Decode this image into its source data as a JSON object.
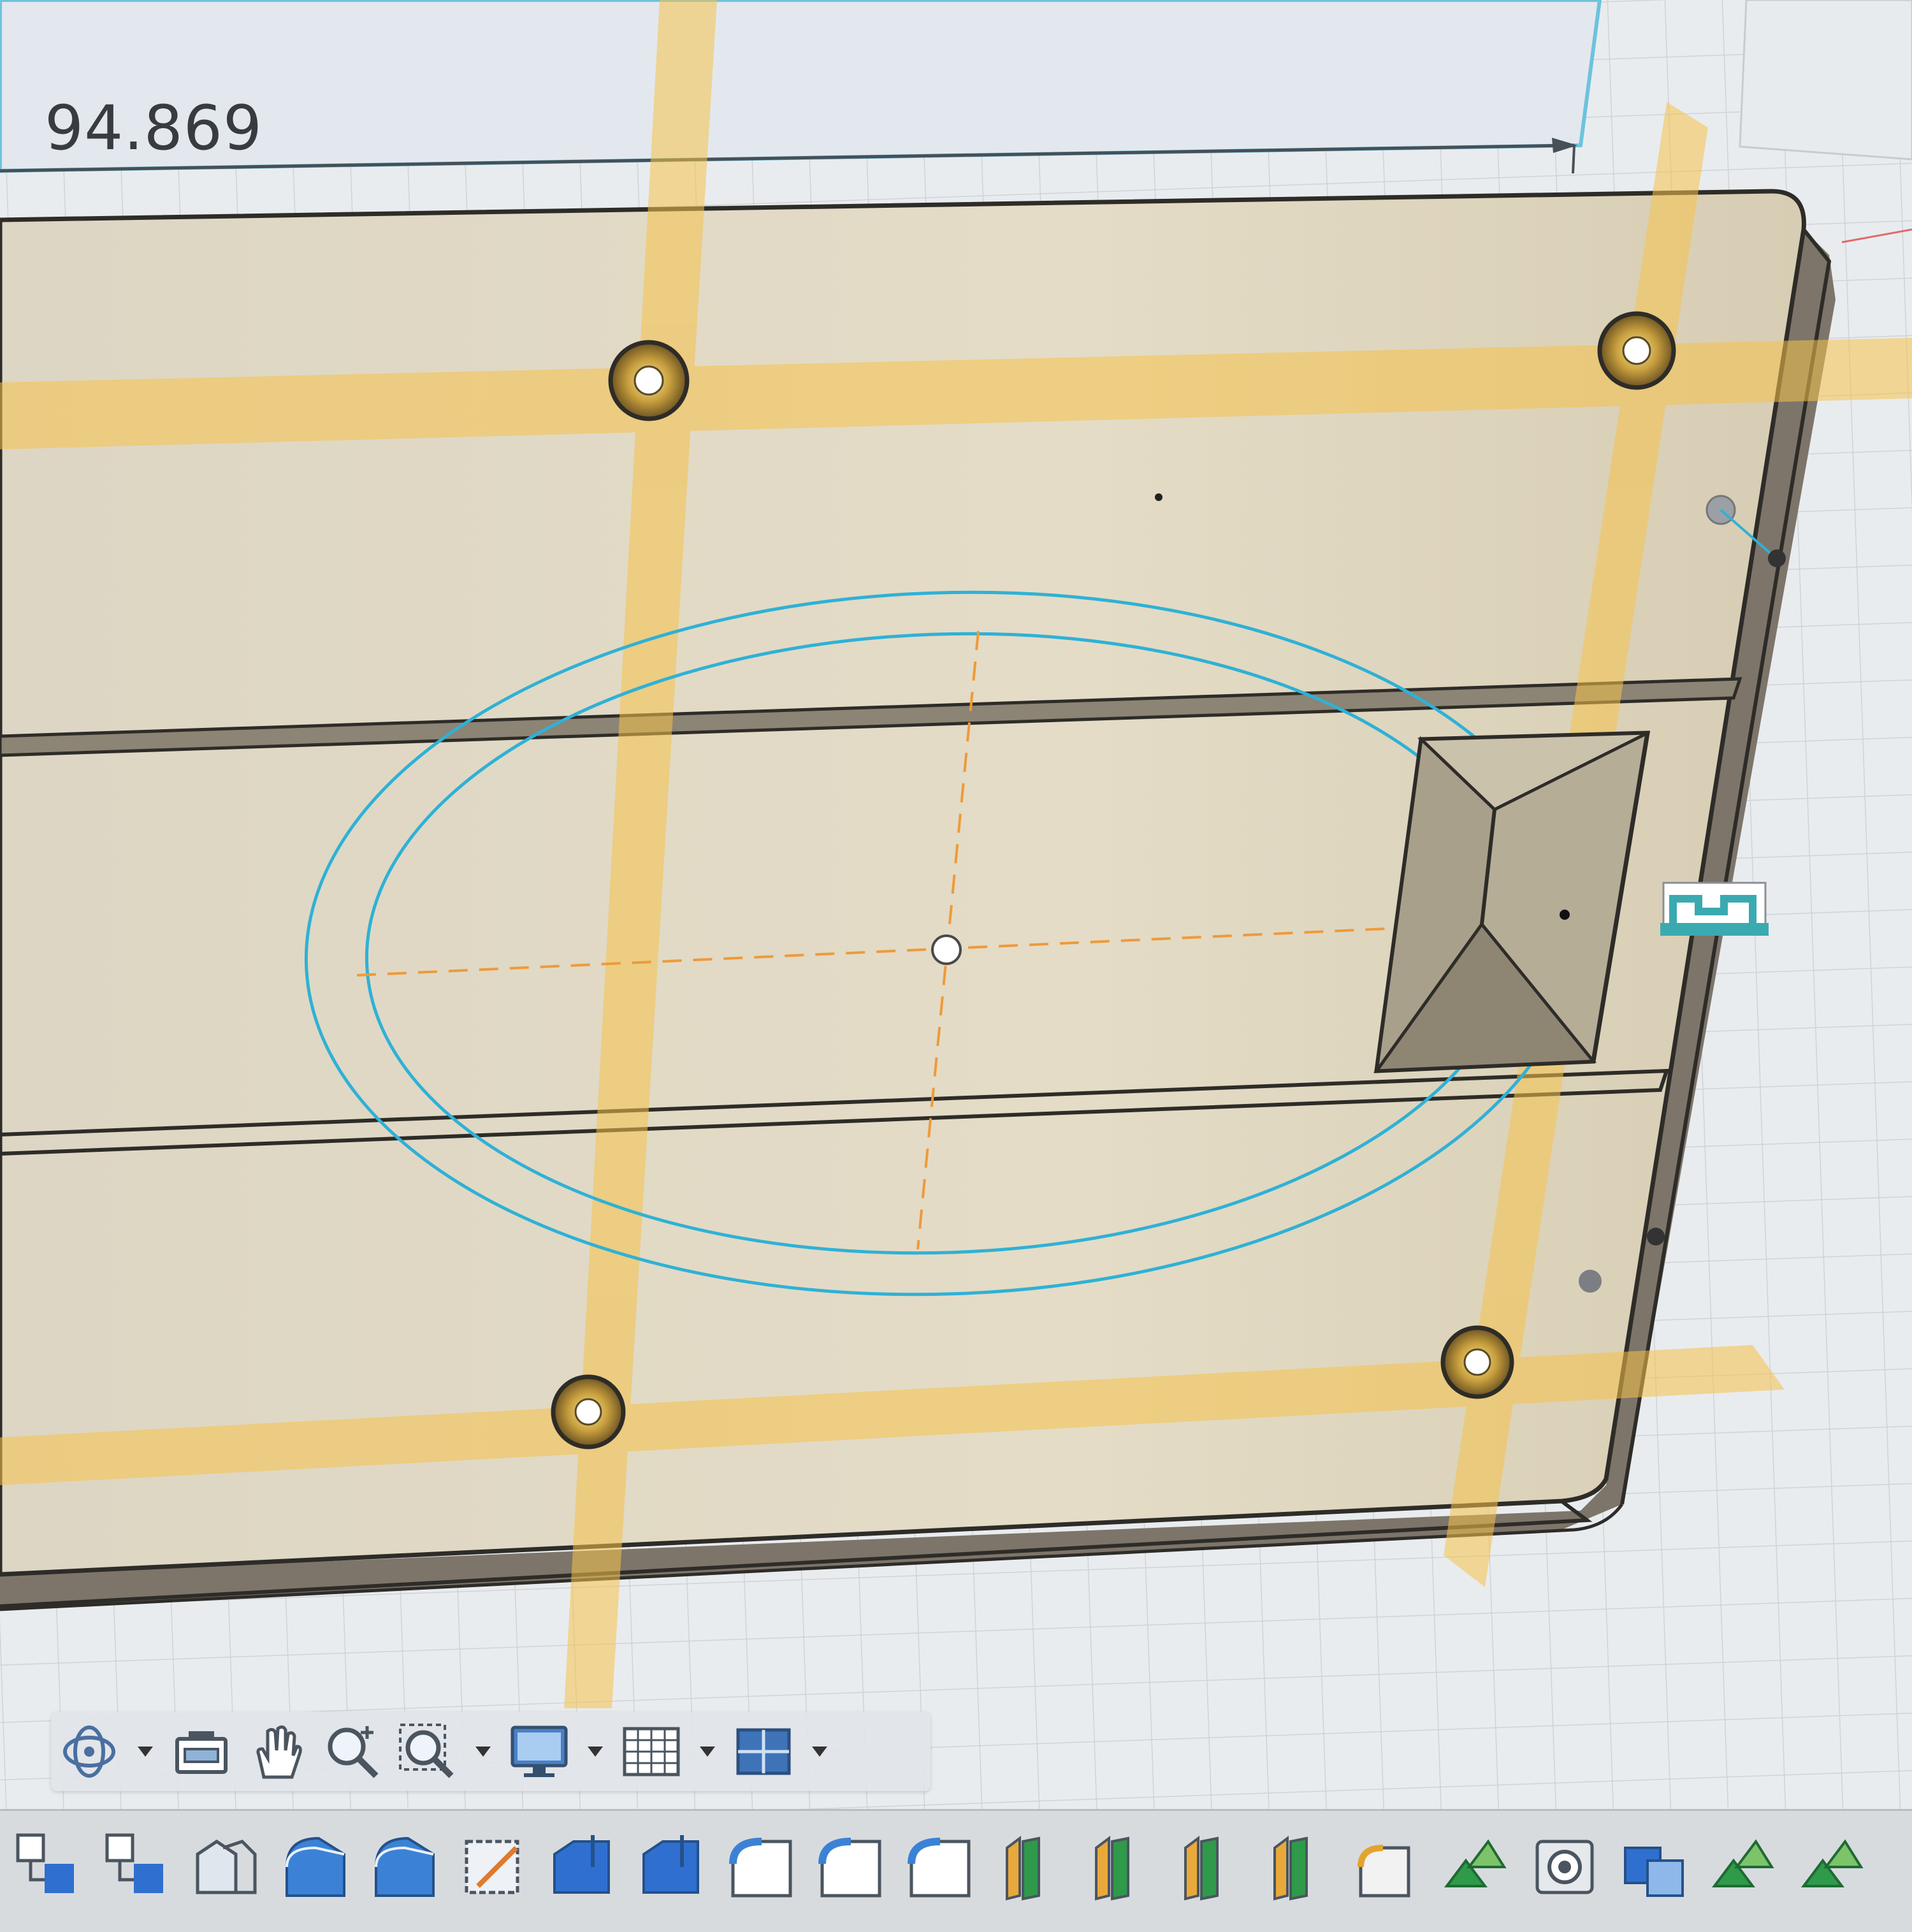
{
  "viewport": {
    "dimension_value": "94.869",
    "colors": {
      "background": "#e9ecef",
      "plate": "#ddd5c2",
      "plate_edge": "#2e2c28",
      "construction_yellow": "#f6c24a",
      "sketch_blue": "#2fb1d6",
      "center_dashed": "#ee9a3a",
      "hole_fill": "#8a6a2e"
    }
  },
  "navigation_toolbar": {
    "items": [
      {
        "icon": "orbit-icon",
        "has_dropdown": true
      },
      {
        "icon": "look-at-icon",
        "has_dropdown": false
      },
      {
        "icon": "pan-hand-icon",
        "has_dropdown": false
      },
      {
        "icon": "zoom-icon",
        "has_dropdown": false
      },
      {
        "icon": "fit-zoom-window-icon",
        "has_dropdown": true
      },
      {
        "icon": "display-settings-icon",
        "has_dropdown": true
      },
      {
        "icon": "grid-snaps-icon",
        "has_dropdown": true
      },
      {
        "icon": "viewports-icon",
        "has_dropdown": true
      }
    ]
  },
  "feature_timeline": {
    "icons": [
      "component-icon",
      "component-icon",
      "sketch-icon",
      "extrude-icon",
      "extrude-icon",
      "sketch-icon",
      "extrude-icon",
      "extrude-icon",
      "fillet-icon",
      "fillet-icon",
      "fillet-icon",
      "plane-icon",
      "plane-icon",
      "plane-icon",
      "plane-icon",
      "fillet-icon",
      "pattern-icon",
      "hole-icon",
      "combine-icon",
      "pattern-icon",
      "pattern-icon"
    ]
  }
}
